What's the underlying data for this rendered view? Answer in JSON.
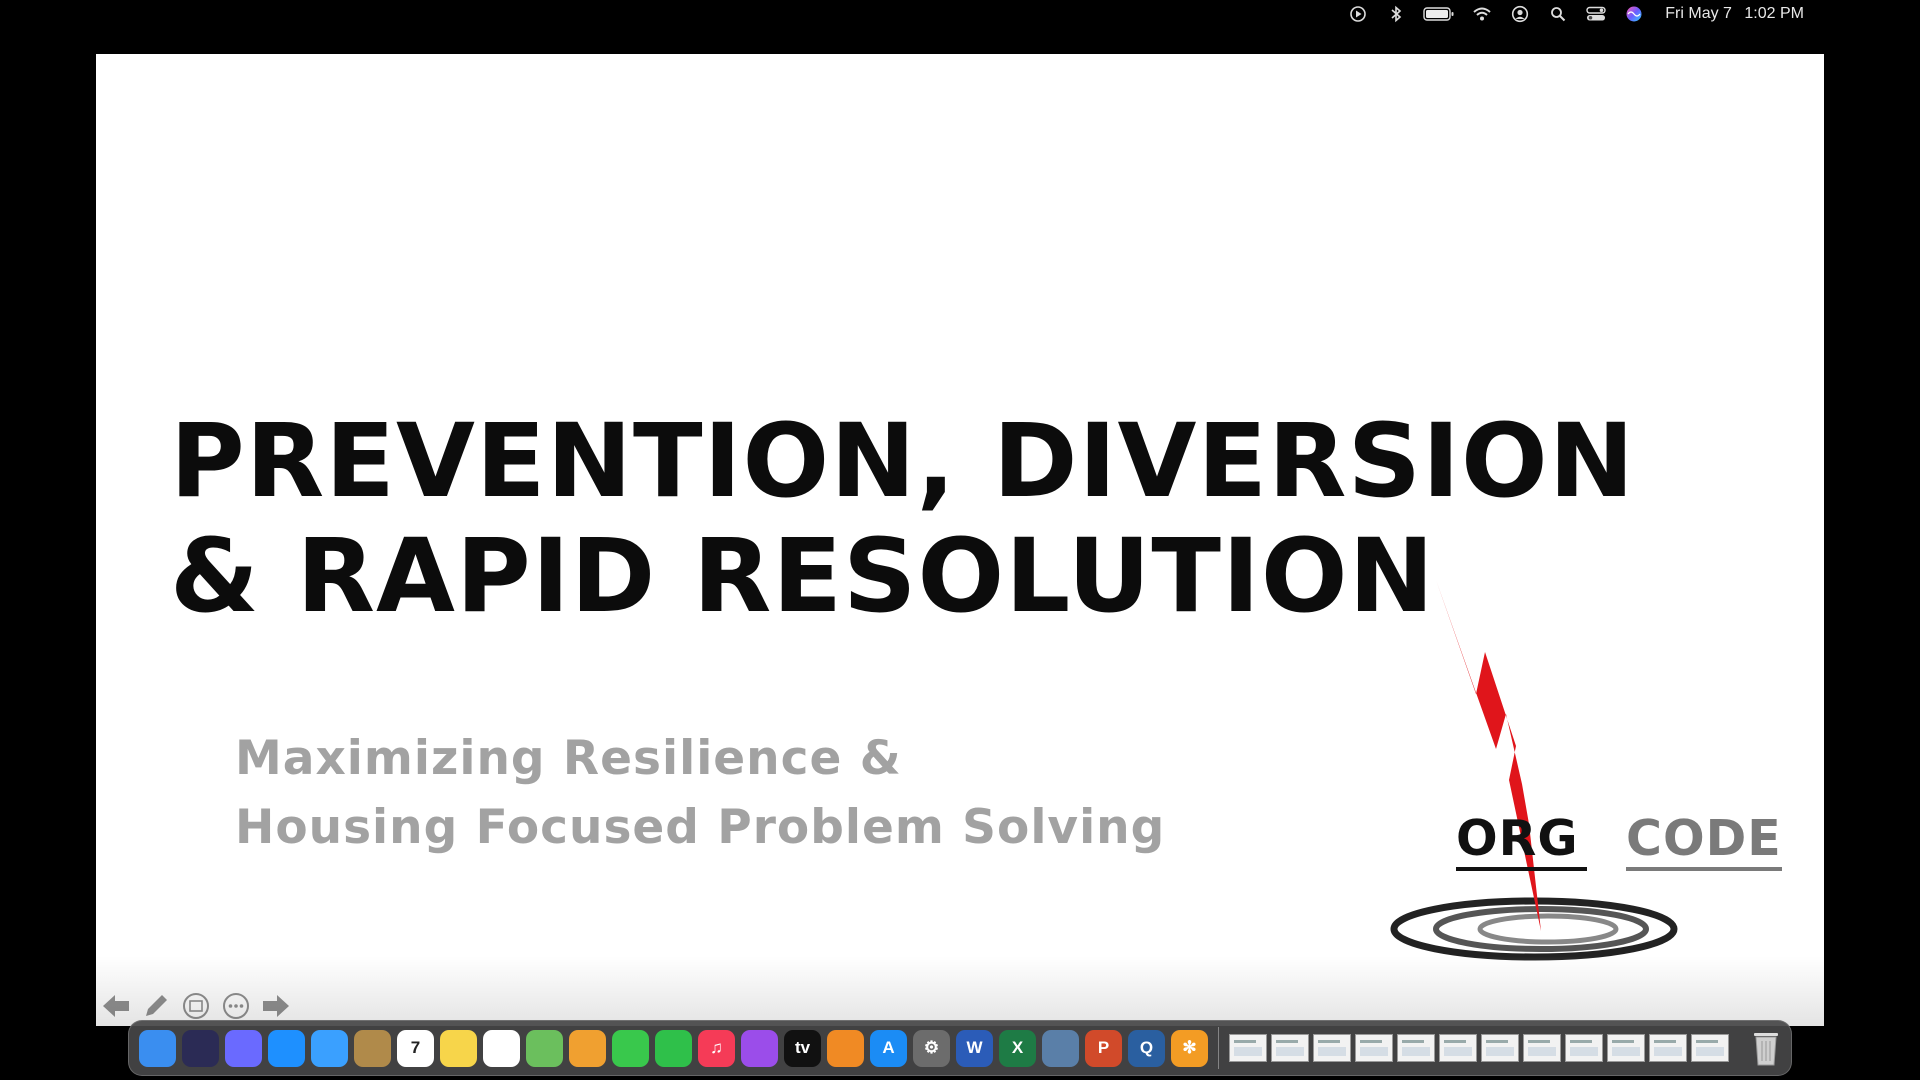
{
  "menubar": {
    "date": "Fri May 7",
    "time": "1:02 PM",
    "icons": [
      "play-circle-icon",
      "bluetooth-icon",
      "battery-icon",
      "wifi-icon",
      "user-circle-icon",
      "search-icon",
      "control-center-icon",
      "siri-icon"
    ]
  },
  "slide": {
    "title_line1": "PREVENTION, DIVERSION",
    "title_line2": "& RAPID RESOLUTION",
    "subtitle_line1": "Maximizing Resilience &",
    "subtitle_line2": "Housing Focused Problem Solving",
    "logo": {
      "word_left": "ORG",
      "word_right": "CODE",
      "bolt_color": "#e0151b"
    }
  },
  "presenter_controls": [
    "previous-arrow-icon",
    "pen-icon",
    "slides-grid-icon",
    "more-options-icon",
    "next-arrow-icon"
  ],
  "dock": {
    "apps": [
      {
        "name": "finder",
        "label": "",
        "color": "#3a8ef0"
      },
      {
        "name": "siri",
        "label": "",
        "color": "#2b2b55"
      },
      {
        "name": "launchpad",
        "label": "",
        "color": "#6a6aff"
      },
      {
        "name": "safari",
        "label": "",
        "color": "#1e90ff"
      },
      {
        "name": "mail",
        "label": "",
        "color": "#3aa0ff"
      },
      {
        "name": "contacts",
        "label": "",
        "color": "#b08a4a"
      },
      {
        "name": "calendar",
        "label": "7",
        "color": "#ffffff"
      },
      {
        "name": "notes",
        "label": "",
        "color": "#f7d54a"
      },
      {
        "name": "reminders",
        "label": "",
        "color": "#ffffff"
      },
      {
        "name": "maps",
        "label": "",
        "color": "#6bbf5d"
      },
      {
        "name": "photos",
        "label": "",
        "color": "#f0a030"
      },
      {
        "name": "messages",
        "label": "",
        "color": "#39c84c"
      },
      {
        "name": "facetime",
        "label": "",
        "color": "#2fc04a"
      },
      {
        "name": "music",
        "label": "♫",
        "color": "#f53b57"
      },
      {
        "name": "podcasts",
        "label": "",
        "color": "#9b4dea"
      },
      {
        "name": "tv",
        "label": "tv",
        "color": "#111111"
      },
      {
        "name": "books",
        "label": "",
        "color": "#f08a24"
      },
      {
        "name": "app-store",
        "label": "A",
        "color": "#1b8cf5"
      },
      {
        "name": "system-preferences",
        "label": "⚙",
        "color": "#6c6c6c"
      },
      {
        "name": "word",
        "label": "W",
        "color": "#2b5cb8"
      },
      {
        "name": "excel",
        "label": "X",
        "color": "#1e7b45"
      },
      {
        "name": "preview",
        "label": "",
        "color": "#5a7fa8"
      },
      {
        "name": "powerpoint",
        "label": "P",
        "color": "#d14a2a"
      },
      {
        "name": "quicktime",
        "label": "Q",
        "color": "#2a5fa0"
      },
      {
        "name": "photo-editor",
        "label": "✻",
        "color": "#f39c24"
      }
    ],
    "thumbnail_count": 12
  }
}
